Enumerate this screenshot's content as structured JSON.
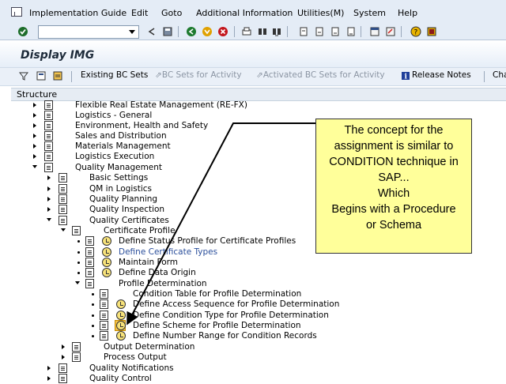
{
  "menu": {
    "items": [
      "Implementation Guide",
      "Edit",
      "Goto",
      "Additional Information",
      "Utilities(M)",
      "System",
      "Help"
    ]
  },
  "toolbar": {
    "command_field_value": "",
    "icons": [
      "enter-icon",
      "back-icon",
      "save-icon",
      "back-nav-icon",
      "exit-icon",
      "cancel-icon",
      "print-icon",
      "find-icon",
      "find-next-icon",
      "first-page-icon",
      "previous-page-icon",
      "next-page-icon",
      "last-page-icon",
      "new-session-icon",
      "shortcut-icon",
      "help-icon",
      "layout-icon"
    ]
  },
  "screen": {
    "title": "Display IMG"
  },
  "app_toolbar": {
    "existing_bc_sets": "Existing BC Sets",
    "bc_sets_for_activity": "BC Sets for Activity",
    "activated_bc_sets": "Activated BC Sets for Activity",
    "release_notes": "Release Notes",
    "overflow": "Cha"
  },
  "structure": {
    "header": "Structure",
    "rows": [
      {
        "label": "Flexible Real Estate Management (RE-FX)"
      },
      {
        "label": "Logistics - General"
      },
      {
        "label": "Environment, Health and Safety"
      },
      {
        "label": "Sales and Distribution"
      },
      {
        "label": "Materials Management"
      },
      {
        "label": "Logistics Execution"
      },
      {
        "label": "Quality Management"
      },
      {
        "label": "Basic Settings"
      },
      {
        "label": "QM in Logistics"
      },
      {
        "label": "Quality Planning"
      },
      {
        "label": "Quality Inspection"
      },
      {
        "label": "Quality Certificates"
      },
      {
        "label": "Certificate Profile"
      },
      {
        "label": "Define Status Profile for Certificate Profiles"
      },
      {
        "label": "Define Certificate Types"
      },
      {
        "label": "Maintain Form"
      },
      {
        "label": "Define Data Origin"
      },
      {
        "label": "Profile Determination"
      },
      {
        "label": "Condition Table for Profile Determination"
      },
      {
        "label": "Define Access Sequence for Profile Determination"
      },
      {
        "label": "Define Condition Type for Profile Determination"
      },
      {
        "label": "Define Scheme for Profile Determination"
      },
      {
        "label": "Define Number Range for Condition Records"
      },
      {
        "label": "Output Determination"
      },
      {
        "label": "Process Output"
      },
      {
        "label": "Quality Notifications"
      },
      {
        "label": "Quality Control"
      }
    ]
  },
  "callout": {
    "lines": [
      "The concept for the",
      "assignment is similar to",
      "CONDITION technique in",
      "SAP...",
      "Which",
      "Begins with a Procedure",
      "or Schema"
    ]
  },
  "colors": {
    "callout_bg": "#ffff9a",
    "link": "#2a4e9b",
    "chrome": "#e4ecf6"
  }
}
